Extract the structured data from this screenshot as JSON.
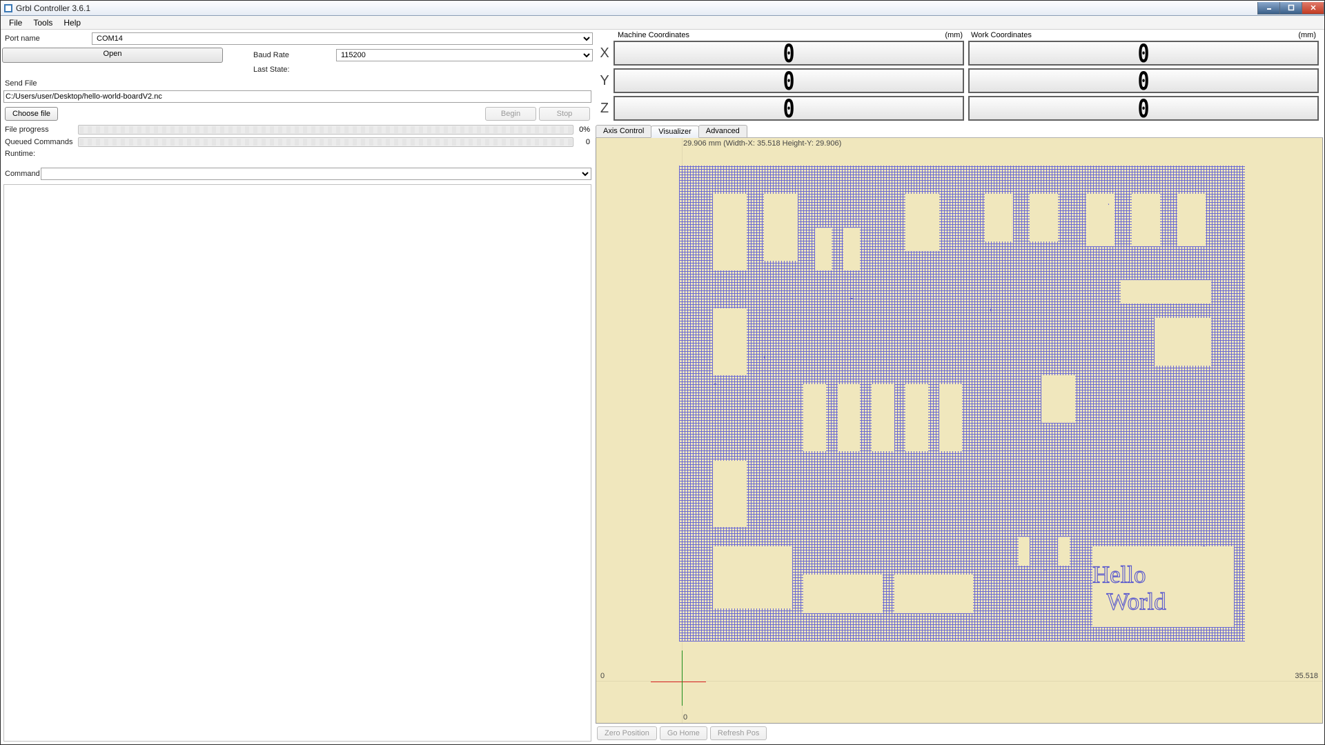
{
  "window": {
    "title": "Grbl Controller 3.6.1"
  },
  "menu": {
    "file": "File",
    "tools": "Tools",
    "help": "Help"
  },
  "port": {
    "label": "Port name",
    "value": "COM14",
    "open": "Open",
    "baud_label": "Baud Rate",
    "baud_value": "115200",
    "last_state_label": "Last State:",
    "last_state_value": ""
  },
  "sendfile": {
    "label": "Send File",
    "path": "C:/Users/user/Desktop/hello-world-boardV2.nc",
    "choose": "Choose file",
    "begin": "Begin",
    "stop": "Stop",
    "file_progress_label": "File progress",
    "file_progress_pct": "0%",
    "queued_label": "Queued Commands",
    "queued_count": "0",
    "runtime_label": "Runtime:",
    "runtime_value": ""
  },
  "command": {
    "label": "Command"
  },
  "coords": {
    "machine_label": "Machine Coordinates",
    "machine_unit": "(mm)",
    "work_label": "Work Coordinates",
    "work_unit": "(mm)",
    "axes": [
      "X",
      "Y",
      "Z"
    ],
    "machine": {
      "X": "0",
      "Y": "0",
      "Z": "0"
    },
    "work": {
      "X": "0",
      "Y": "0",
      "Z": "0"
    }
  },
  "tabs": {
    "axis": "Axis Control",
    "visualizer": "Visualizer",
    "advanced": "Advanced"
  },
  "visualizer": {
    "top_meta": "29.906 mm   (Width-X: 35.518  Height-Y: 29.906)",
    "y0": "0",
    "x0": "0",
    "xmax": "35.518"
  },
  "footer": {
    "zero": "Zero Position",
    "home": "Go Home",
    "refresh": "Refresh Pos"
  }
}
